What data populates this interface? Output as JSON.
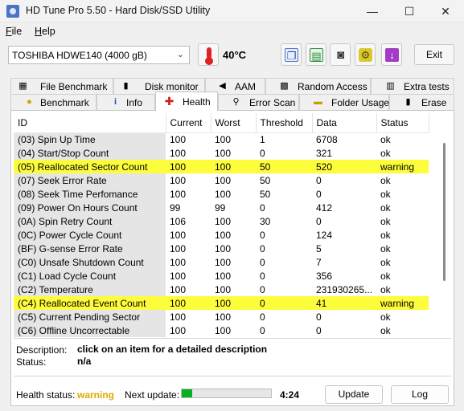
{
  "window": {
    "title": "HD Tune Pro 5.50 - Hard Disk/SSD Utility",
    "minimize": "—",
    "maximize": "☐",
    "close": "✕"
  },
  "menu": [
    {
      "mnemonic": "F",
      "rest": "ile"
    },
    {
      "mnemonic": "H",
      "rest": "elp"
    }
  ],
  "toolbar": {
    "drive": "TOSHIBA HDWE140 (4000 gB)",
    "temperature": "40°C",
    "exit_label": "Exit"
  },
  "icons": {
    "app": "hd-tune-icon",
    "thermometer": "thermometer-icon",
    "copy_info": "copy-icon",
    "save": "save-icon",
    "screenshot": "camera-icon",
    "options": "options-icon",
    "download": "download-icon"
  },
  "tabs_row1": [
    {
      "label": "File Benchmark",
      "icon": "file-benchmark-icon"
    },
    {
      "label": "Disk monitor",
      "icon": "disk-monitor-icon"
    },
    {
      "label": "AAM",
      "icon": "speaker-icon"
    },
    {
      "label": "Random Access",
      "icon": "random-access-icon"
    },
    {
      "label": "Extra tests",
      "icon": "extra-tests-icon"
    }
  ],
  "tabs_row2": [
    {
      "label": "Benchmark",
      "icon": "benchmark-icon"
    },
    {
      "label": "Info",
      "icon": "info-icon"
    },
    {
      "label": "Health",
      "icon": "health-cross-icon",
      "active": true
    },
    {
      "label": "Error Scan",
      "icon": "magnifier-icon"
    },
    {
      "label": "Folder Usage",
      "icon": "folder-icon"
    },
    {
      "label": "Erase",
      "icon": "trash-icon"
    }
  ],
  "table": {
    "columns": [
      "ID",
      "Current",
      "Worst",
      "Threshold",
      "Data",
      "Status"
    ],
    "rows": [
      [
        "(03) Spin Up Time",
        "100",
        "100",
        "1",
        "6708",
        "ok"
      ],
      [
        "(04) Start/Stop Count",
        "100",
        "100",
        "0",
        "321",
        "ok"
      ],
      [
        "(05) Reallocated Sector Count",
        "100",
        "100",
        "50",
        "520",
        "warning"
      ],
      [
        "(07) Seek Error Rate",
        "100",
        "100",
        "50",
        "0",
        "ok"
      ],
      [
        "(08) Seek Time Perfomance",
        "100",
        "100",
        "50",
        "0",
        "ok"
      ],
      [
        "(09) Power On Hours Count",
        "99",
        "99",
        "0",
        "412",
        "ok"
      ],
      [
        "(0A) Spin Retry Count",
        "106",
        "100",
        "30",
        "0",
        "ok"
      ],
      [
        "(0C) Power Cycle Count",
        "100",
        "100",
        "0",
        "124",
        "ok"
      ],
      [
        "(BF) G-sense Error Rate",
        "100",
        "100",
        "0",
        "5",
        "ok"
      ],
      [
        "(C0) Unsafe Shutdown Count",
        "100",
        "100",
        "0",
        "7",
        "ok"
      ],
      [
        "(C1) Load Cycle Count",
        "100",
        "100",
        "0",
        "356",
        "ok"
      ],
      [
        "(C2) Temperature",
        "100",
        "100",
        "0",
        "231930265...",
        "ok"
      ],
      [
        "(C4) Reallocated Event Count",
        "100",
        "100",
        "0",
        "41",
        "warning"
      ],
      [
        "(C5) Current Pending Sector",
        "100",
        "100",
        "0",
        "0",
        "ok"
      ],
      [
        "(C6) Offline Uncorrectable",
        "100",
        "100",
        "0",
        "0",
        "ok"
      ]
    ]
  },
  "description": {
    "label": "Description:",
    "value": "click on an item for a detailed description"
  },
  "status": {
    "label": "Status:",
    "value": "n/a"
  },
  "footer": {
    "health_label": "Health status:",
    "health_value": "warning",
    "next_update_label": "Next update:",
    "progress_fraction": 0.12,
    "time": "4:24",
    "update_label": "Update",
    "log_label": "Log"
  },
  "colors": {
    "warning_row": "#fdfd3c",
    "warning_text": "#e0a800",
    "progress": "#06b025"
  }
}
